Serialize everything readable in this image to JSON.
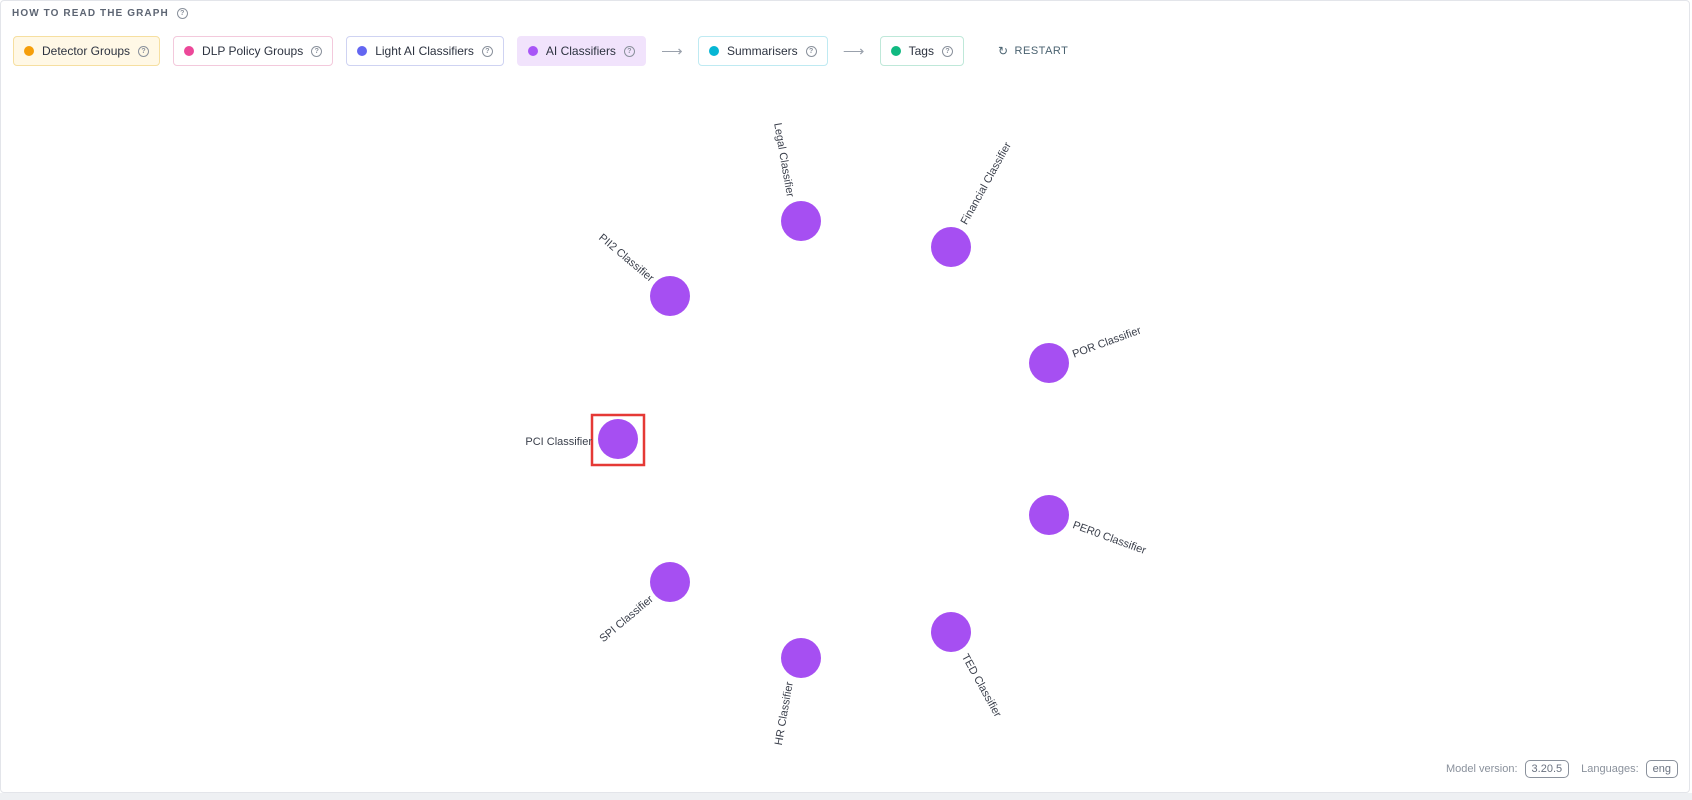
{
  "header": {
    "how_to_read": "HOW TO READ THE GRAPH",
    "help_icon": "question-circle-icon"
  },
  "legend": {
    "items": [
      {
        "label": "Detector Groups",
        "color": "#f59e0b"
      },
      {
        "label": "DLP Policy Groups",
        "color": "#ec4899"
      },
      {
        "label": "Light AI Classifiers",
        "color": "#6366f1"
      },
      {
        "label": "AI Classifiers",
        "color": "#a855f7"
      },
      {
        "label": "Summarisers",
        "color": "#06b6d4"
      },
      {
        "label": "Tags",
        "color": "#10b981"
      }
    ],
    "arrow_glyph": "⟶",
    "restart_label": "RESTART",
    "restart_icon": "refresh-icon"
  },
  "graph": {
    "node_color": "#a64ff2",
    "highlight_color": "#e53935",
    "nodes": [
      {
        "id": "legal",
        "label": "Legal Classifier"
      },
      {
        "id": "financial",
        "label": "Financial Classifier"
      },
      {
        "id": "pii2",
        "label": "PII2 Classifier"
      },
      {
        "id": "por",
        "label": "POR Classifier"
      },
      {
        "id": "pci",
        "label": "PCI Classifier"
      },
      {
        "id": "per0",
        "label": "PER0 Classifier"
      },
      {
        "id": "spi",
        "label": "SPI Classifier"
      },
      {
        "id": "ted",
        "label": "TED Classifier"
      },
      {
        "id": "hr",
        "label": "HR Classifier"
      }
    ],
    "selected_node": "pci"
  },
  "footer": {
    "model_version_label": "Model version:",
    "model_version": "3.20.5",
    "languages_label": "Languages:",
    "languages": "eng"
  }
}
